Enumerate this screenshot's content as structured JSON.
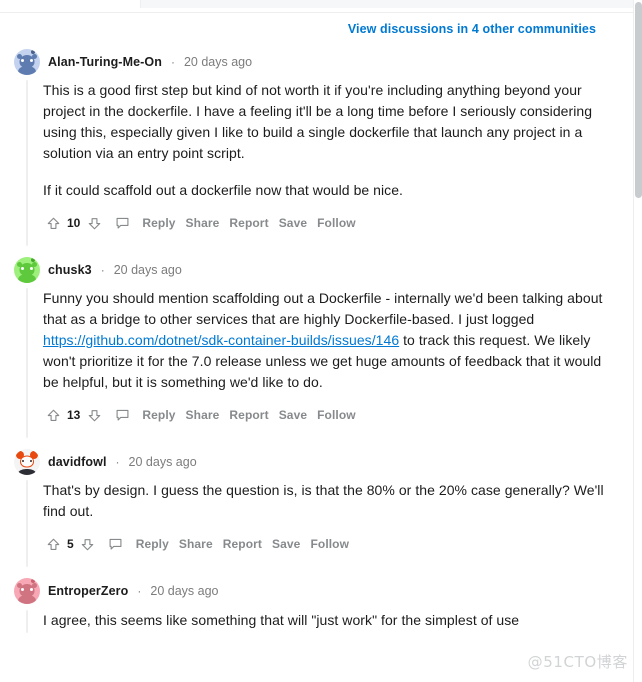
{
  "header": {
    "communities_link": "View discussions in 4 other communities"
  },
  "action_labels": {
    "reply": "Reply",
    "share": "Share",
    "report": "Report",
    "save": "Save",
    "follow": "Follow"
  },
  "icons": {
    "upvote": "upvote-arrow-icon",
    "downvote": "downvote-arrow-icon",
    "comment_bubble": "comment-bubble-icon"
  },
  "meta_separator": "·",
  "comments": [
    {
      "username": "Alan-Turing-Me-On",
      "timestamp": "20 days ago",
      "avatar_color": "#7193c8",
      "avatar_accent": "#4a5f8a",
      "score": "10",
      "paragraphs": [
        "This is a good first step but kind of not worth it if you're including anything beyond your project in the dockerfile. I have a feeling it'll be a long time before I seriously considering using this, especially given I like to build a single dockerfile that launch any project in a solution via an entry point script.",
        "If it could scaffold out a dockerfile now that would be nice."
      ]
    },
    {
      "username": "chusk3",
      "timestamp": "20 days ago",
      "avatar_color": "#6ddb4a",
      "avatar_accent": "#46a62c",
      "score": "13",
      "text_before": "Funny you should mention scaffolding out a Dockerfile - internally we'd been talking about that as a bridge to other services that are highly Dockerfile-based. I just logged ",
      "link_text": "https://github.com/dotnet/sdk-container-builds/issues/146",
      "text_after": " to track this request. We likely won't prioritize it for the 7.0 release unless we get huge amounts of feedback that it would be helpful, but it is something we'd like to do."
    },
    {
      "username": "davidfowl",
      "timestamp": "20 days ago",
      "avatar_color": "#f2f2f2",
      "avatar_accent": "#e8490f",
      "score": "5",
      "paragraphs": [
        "That's by design. I guess the question is, is that the 80% or the 20% case generally? We'll find out."
      ]
    },
    {
      "username": "EntroperZero",
      "timestamp": "20 days ago",
      "avatar_color": "#f59ba8",
      "avatar_accent": "#c96470",
      "score": "",
      "paragraphs": [
        "I agree, this seems like something that will \"just work\" for the simplest of use"
      ]
    }
  ],
  "watermark": "@51CTO博客"
}
